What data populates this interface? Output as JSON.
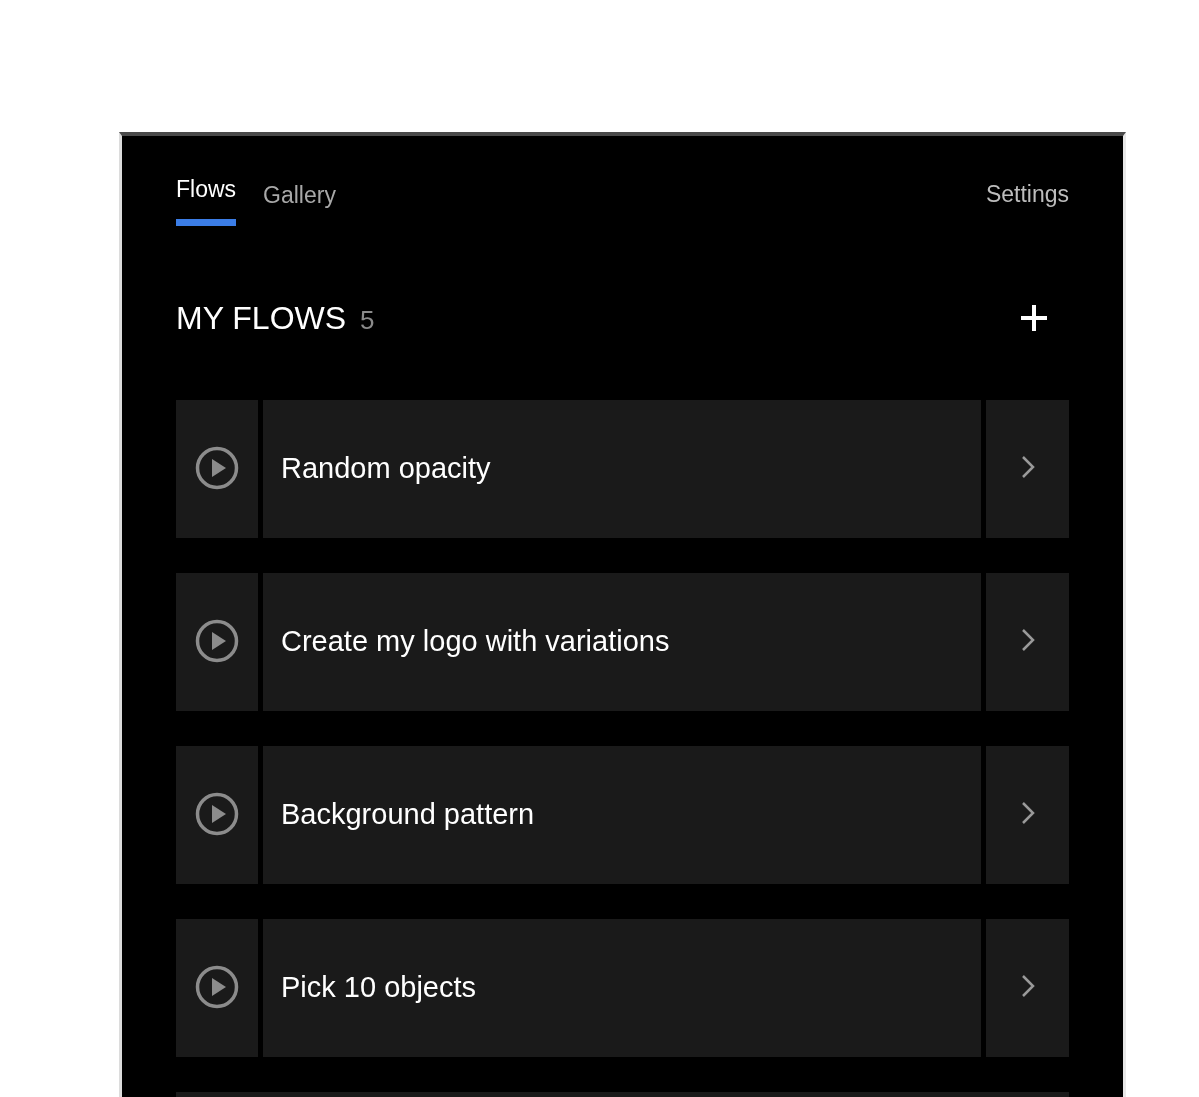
{
  "tabs": [
    {
      "label": "Flows",
      "selected": true
    },
    {
      "label": "Gallery",
      "selected": false
    }
  ],
  "settings": "Settings",
  "heading": {
    "title": "MY FLOWS",
    "count": "5"
  },
  "flows": [
    {
      "name": "Random opacity"
    },
    {
      "name": "Create my logo with variations"
    },
    {
      "name": "Background pattern"
    },
    {
      "name": "Pick 10 objects"
    }
  ],
  "more_rows_below": true
}
